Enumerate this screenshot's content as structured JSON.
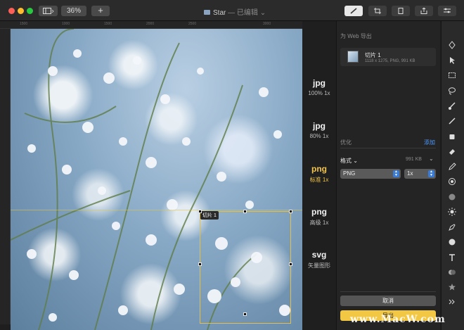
{
  "window": {
    "title": "Star",
    "title_suffix": "— 已编辑",
    "zoom_label": "36%",
    "add_label": "+"
  },
  "ruler": {
    "ticks": [
      "1500",
      "1000",
      "1500",
      "2000",
      "2500",
      "3000"
    ]
  },
  "canvas": {
    "slice_label": "切片 1"
  },
  "formats": [
    {
      "name": "jpg",
      "detail": "100% 1x"
    },
    {
      "name": "jpg",
      "detail": "80% 1x"
    },
    {
      "name": "png",
      "detail": "标准 1x",
      "selected": true
    },
    {
      "name": "png",
      "detail": "高级 1x"
    },
    {
      "name": "svg",
      "detail": "矢量图形"
    }
  ],
  "panel": {
    "header": "为 Web 导出",
    "slice_name": "切片 1",
    "slice_meta": "1118 x 1275, PNG, 991 KB",
    "optimize_label": "优化",
    "add_label": "添加",
    "format_label": "格式",
    "format_chevron": "⌄",
    "format_size": "991 KB",
    "format_value": "PNG",
    "scale_value": "1x",
    "cancel_label": "取消",
    "export_label": "导出"
  },
  "tools": [
    "pen-nib",
    "pointer",
    "rectangle-select",
    "lasso",
    "paint-brush",
    "line",
    "paint-bucket",
    "eraser",
    "pencil",
    "clone",
    "gradient",
    "brightness",
    "pen",
    "shape",
    "text",
    "color-picker",
    "star",
    "more"
  ],
  "watermark": "www.MacW.com",
  "colors": {
    "accent": "#f3c54a",
    "link": "#4f9bff",
    "selection": "#e3c04b"
  }
}
